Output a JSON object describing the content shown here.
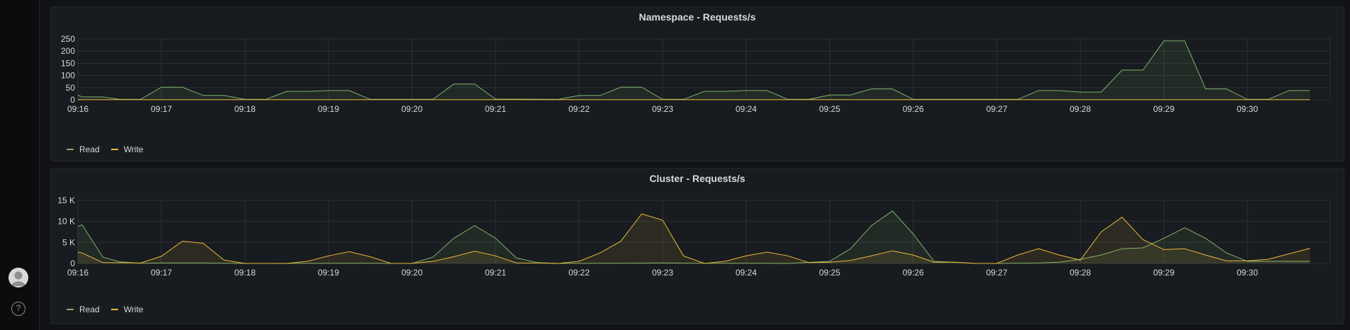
{
  "nav": {
    "avatar": "user-avatar",
    "help_label": "?"
  },
  "colors": {
    "read": "#7eb26d",
    "write": "#eab839",
    "grid": "#2c3036",
    "text": "#d8d9da"
  },
  "time_labels": [
    "09:16",
    "09:17",
    "09:18",
    "09:19",
    "09:20",
    "09:21",
    "09:22",
    "09:23",
    "09:24",
    "09:25",
    "09:26",
    "09:27",
    "09:28",
    "09:29",
    "09:30"
  ],
  "panels": [
    {
      "title": "Namespace - Requests/s",
      "legend": [
        {
          "label": "Read",
          "color": "#7eb26d"
        },
        {
          "label": "Write",
          "color": "#eab839"
        }
      ],
      "chart_data": {
        "type": "area",
        "y_ticks": [
          "0",
          "50",
          "100",
          "150",
          "200",
          "250"
        ],
        "ylim": [
          0,
          250
        ],
        "x_range": [
          0,
          14.75
        ],
        "series": [
          {
            "name": "Read",
            "color": "#7eb26d",
            "points": [
              [
                0,
                20
              ],
              [
                0.05,
                12
              ],
              [
                0.3,
                12
              ],
              [
                0.5,
                2
              ],
              [
                0.75,
                2
              ],
              [
                1,
                52
              ],
              [
                1.25,
                52
              ],
              [
                1.5,
                18
              ],
              [
                1.75,
                18
              ],
              [
                2,
                2
              ],
              [
                2.25,
                2
              ],
              [
                2.5,
                35
              ],
              [
                2.75,
                35
              ],
              [
                3,
                38
              ],
              [
                3.25,
                38
              ],
              [
                3.5,
                2
              ],
              [
                4.25,
                2
              ],
              [
                4.5,
                65
              ],
              [
                4.75,
                65
              ],
              [
                5,
                3
              ],
              [
                5.25,
                3
              ],
              [
                5.75,
                2
              ],
              [
                6,
                18
              ],
              [
                6.25,
                18
              ],
              [
                6.5,
                52
              ],
              [
                6.75,
                52
              ],
              [
                7,
                2
              ],
              [
                7.25,
                2
              ],
              [
                7.5,
                35
              ],
              [
                7.75,
                35
              ],
              [
                8,
                38
              ],
              [
                8.25,
                38
              ],
              [
                8.5,
                2
              ],
              [
                8.75,
                2
              ],
              [
                9,
                20
              ],
              [
                9.25,
                20
              ],
              [
                9.5,
                45
              ],
              [
                9.75,
                45
              ],
              [
                10,
                2
              ],
              [
                11.25,
                2
              ],
              [
                11.5,
                38
              ],
              [
                11.75,
                38
              ],
              [
                12,
                32
              ],
              [
                12.25,
                32
              ],
              [
                12.5,
                122
              ],
              [
                12.75,
                122
              ],
              [
                13,
                242
              ],
              [
                13.25,
                242
              ],
              [
                13.5,
                45
              ],
              [
                13.75,
                45
              ],
              [
                14,
                2
              ],
              [
                14.25,
                2
              ],
              [
                14.5,
                38
              ],
              [
                14.75,
                38
              ]
            ]
          },
          {
            "name": "Write",
            "color": "#eab839",
            "points": [
              [
                0,
                1
              ],
              [
                14.75,
                1
              ]
            ]
          }
        ]
      }
    },
    {
      "title": "Cluster - Requests/s",
      "legend": [
        {
          "label": "Read",
          "color": "#7eb26d"
        },
        {
          "label": "Write",
          "color": "#eab839"
        }
      ],
      "chart_data": {
        "type": "area",
        "y_ticks": [
          "0",
          "5 K",
          "10 K",
          "15 K"
        ],
        "ylim": [
          0,
          15000
        ],
        "x_range": [
          0,
          14.75
        ],
        "series": [
          {
            "name": "Read",
            "color": "#7eb26d",
            "points": [
              [
                0,
                8800
              ],
              [
                0.05,
                9200
              ],
              [
                0.3,
                1500
              ],
              [
                0.5,
                400
              ],
              [
                0.75,
                50
              ],
              [
                1,
                100
              ],
              [
                1.5,
                100
              ],
              [
                2,
                0
              ],
              [
                3.5,
                50
              ],
              [
                3.75,
                0
              ],
              [
                4,
                0
              ],
              [
                4.25,
                1500
              ],
              [
                4.5,
                6000
              ],
              [
                4.75,
                9000
              ],
              [
                5,
                6000
              ],
              [
                5.25,
                1300
              ],
              [
                5.5,
                200
              ],
              [
                5.75,
                0
              ],
              [
                6.5,
                50
              ],
              [
                7,
                100
              ],
              [
                7.5,
                50
              ],
              [
                8,
                50
              ],
              [
                8.5,
                0
              ],
              [
                9,
                500
              ],
              [
                9.25,
                3500
              ],
              [
                9.5,
                9000
              ],
              [
                9.75,
                12500
              ],
              [
                10,
                7000
              ],
              [
                10.25,
                500
              ],
              [
                10.5,
                300
              ],
              [
                10.75,
                0
              ],
              [
                11,
                0
              ],
              [
                11.5,
                100
              ],
              [
                11.75,
                300
              ],
              [
                12,
                1000
              ],
              [
                12.25,
                2000
              ],
              [
                12.5,
                3500
              ],
              [
                12.75,
                3700
              ],
              [
                13,
                6000
              ],
              [
                13.25,
                8500
              ],
              [
                13.5,
                6000
              ],
              [
                13.75,
                2500
              ],
              [
                14,
                500
              ],
              [
                14.25,
                500
              ],
              [
                14.5,
                500
              ],
              [
                14.75,
                500
              ]
            ]
          },
          {
            "name": "Write",
            "color": "#eab839",
            "points": [
              [
                0,
                2700
              ],
              [
                0.05,
                2500
              ],
              [
                0.3,
                200
              ],
              [
                0.75,
                100
              ],
              [
                1,
                1700
              ],
              [
                1.25,
                5300
              ],
              [
                1.5,
                4800
              ],
              [
                1.75,
                800
              ],
              [
                2,
                0
              ],
              [
                2.5,
                0
              ],
              [
                2.75,
                500
              ],
              [
                3,
                1800
              ],
              [
                3.25,
                2800
              ],
              [
                3.5,
                1600
              ],
              [
                3.75,
                0
              ],
              [
                4,
                0
              ],
              [
                4.25,
                500
              ],
              [
                4.5,
                1600
              ],
              [
                4.75,
                2900
              ],
              [
                5,
                1800
              ],
              [
                5.25,
                100
              ],
              [
                5.5,
                100
              ],
              [
                5.75,
                0
              ],
              [
                6,
                500
              ],
              [
                6.25,
                2500
              ],
              [
                6.5,
                5300
              ],
              [
                6.75,
                11800
              ],
              [
                7,
                10300
              ],
              [
                7.25,
                1800
              ],
              [
                7.5,
                0
              ],
              [
                7.75,
                500
              ],
              [
                8,
                1800
              ],
              [
                8.25,
                2700
              ],
              [
                8.5,
                1800
              ],
              [
                8.75,
                200
              ],
              [
                9,
                300
              ],
              [
                9.25,
                700
              ],
              [
                9.5,
                1800
              ],
              [
                9.75,
                3000
              ],
              [
                10,
                2000
              ],
              [
                10.25,
                300
              ],
              [
                10.5,
                300
              ],
              [
                10.75,
                0
              ],
              [
                11,
                0
              ],
              [
                11.25,
                2000
              ],
              [
                11.5,
                3500
              ],
              [
                11.75,
                2000
              ],
              [
                12,
                800
              ],
              [
                12.25,
                7500
              ],
              [
                12.5,
                11000
              ],
              [
                12.75,
                5700
              ],
              [
                13,
                3300
              ],
              [
                13.25,
                3500
              ],
              [
                13.5,
                2000
              ],
              [
                13.75,
                600
              ],
              [
                14,
                600
              ],
              [
                14.25,
                1000
              ],
              [
                14.5,
                2300
              ],
              [
                14.75,
                3600
              ]
            ]
          }
        ]
      }
    }
  ]
}
